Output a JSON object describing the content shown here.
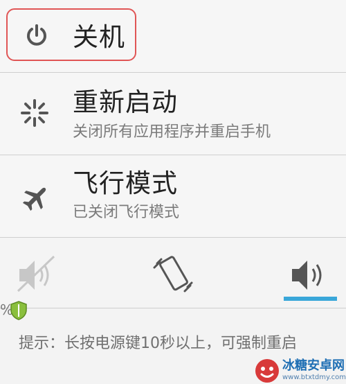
{
  "menu": {
    "power_off": {
      "title": "关机"
    },
    "restart": {
      "title": "重新启动",
      "subtitle": "关闭所有应用程序并重启手机"
    },
    "airplane": {
      "title": "飞行模式",
      "subtitle": "已关闭飞行模式"
    }
  },
  "sound_modes": {
    "selected": "sound-on",
    "accent_color": "#3aa7d9"
  },
  "status": {
    "percent": "%"
  },
  "tip": {
    "text": "提示：长按电源键10秒以上，可强制重启"
  },
  "watermark": {
    "name": "冰糖安卓网",
    "url": "www.btxtdmy.com"
  },
  "colors": {
    "highlight": "#e05555",
    "icon": "#555555"
  }
}
